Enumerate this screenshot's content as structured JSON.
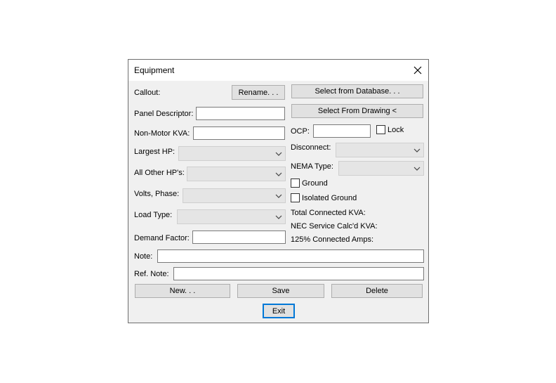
{
  "window": {
    "title": "Equipment"
  },
  "labels": {
    "callout": "Callout:",
    "panel_descriptor": "Panel Descriptor:",
    "non_motor_kva": "Non-Motor KVA:",
    "largest_hp": "Largest HP:",
    "all_other_hps": "All Other HP's:",
    "volts_phase": "Volts, Phase:",
    "load_type": "Load Type:",
    "demand_factor": "Demand Factor:",
    "ocp": "OCP:",
    "lock": "Lock",
    "disconnect": "Disconnect:",
    "nema_type": "NEMA Type:",
    "ground": "Ground",
    "isolated_ground": "Isolated Ground",
    "total_connected_kva": "Total Connected KVA:",
    "nec_service_calcd_kva": "NEC Service Calc'd KVA:",
    "connected_amps_125": "125% Connected Amps:",
    "note": "Note:",
    "ref_note": "Ref. Note:"
  },
  "buttons": {
    "rename": "Rename. . .",
    "select_from_database": "Select from Database. . .",
    "select_from_drawing": "Select From Drawing <",
    "new": "New. . .",
    "save": "Save",
    "delete": "Delete",
    "exit": "Exit"
  },
  "fields": {
    "panel_descriptor": "",
    "non_motor_kva": "",
    "demand_factor": "",
    "ocp": "",
    "note": "",
    "ref_note": ""
  },
  "combos": {
    "largest_hp": "",
    "all_other_hps": "",
    "volts_phase": "",
    "load_type": "",
    "disconnect": "",
    "nema_type": ""
  },
  "checkboxes": {
    "lock": false,
    "ground": false,
    "isolated_ground": false
  },
  "icons": {
    "close": "close-icon",
    "dropdown": "chevron-down-icon"
  }
}
